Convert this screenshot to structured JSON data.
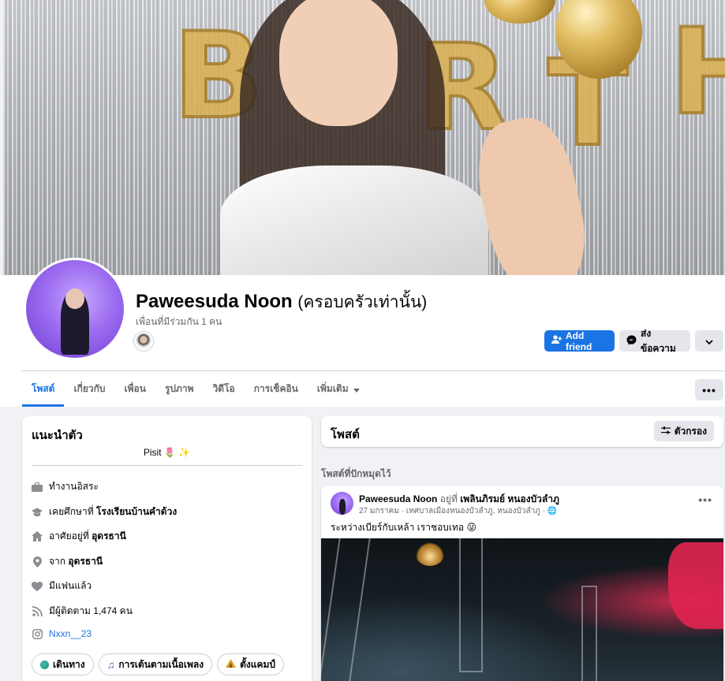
{
  "profile": {
    "name": "Paweesuda Noon",
    "alt_name": "(ครอบครัวเท่านั้น)",
    "mutual_friends": "เพื่อนที่มีร่วมกัน 1 คน"
  },
  "actions": {
    "add_friend": "Add friend",
    "message": "ส่งข้อความ"
  },
  "tabs": [
    "โพสต์",
    "เกี่ยวกับ",
    "เพื่อน",
    "รูปภาพ",
    "วิดีโอ",
    "การเช็คอิน",
    "เพิ่มเติม"
  ],
  "intro": {
    "title": "แนะนำตัว",
    "bio": "Pisit 🌷 ✨",
    "work": "ทำงานอิสระ",
    "education_prefix": "เคยศึกษาที่ ",
    "education_place": "โรงเรียนบ้านคำด้วง",
    "lives_prefix": "อาศัยอยู่ที่ ",
    "lives_place": "อุดรธานี",
    "from_prefix": "จาก ",
    "from_place": "อุดรธานี",
    "relationship": "มีแฟนแล้ว",
    "followers": "มีผู้ติดตาม 1,474 คน",
    "instagram": "Nxxn__23",
    "hobbies": [
      "เดินทาง",
      "การเต้นตามเนื้อเพลง",
      "ตั้งแคมป์"
    ]
  },
  "posts": {
    "title": "โพสต์",
    "filter": "ตัวกรอง",
    "pinned_label": "โพสต์ที่ปักหมุดไว้"
  },
  "post": {
    "author": "Paweesuda Noon",
    "at": " อยู่ที่ ",
    "place": "เพลินภิรมย์ หนองบัวลำภู",
    "meta": "27 มกราคม · เทศบาลเมืองหนองบัวลำภู, หนองบัวลำภู · 🌐",
    "text": "ระหว่างเบียร์กับเหล้า เราชอบเทอ 😜"
  },
  "colors": {
    "primary": "#1b74e4",
    "background": "#f0f2f5",
    "secondary_button": "#e4e6eb"
  }
}
